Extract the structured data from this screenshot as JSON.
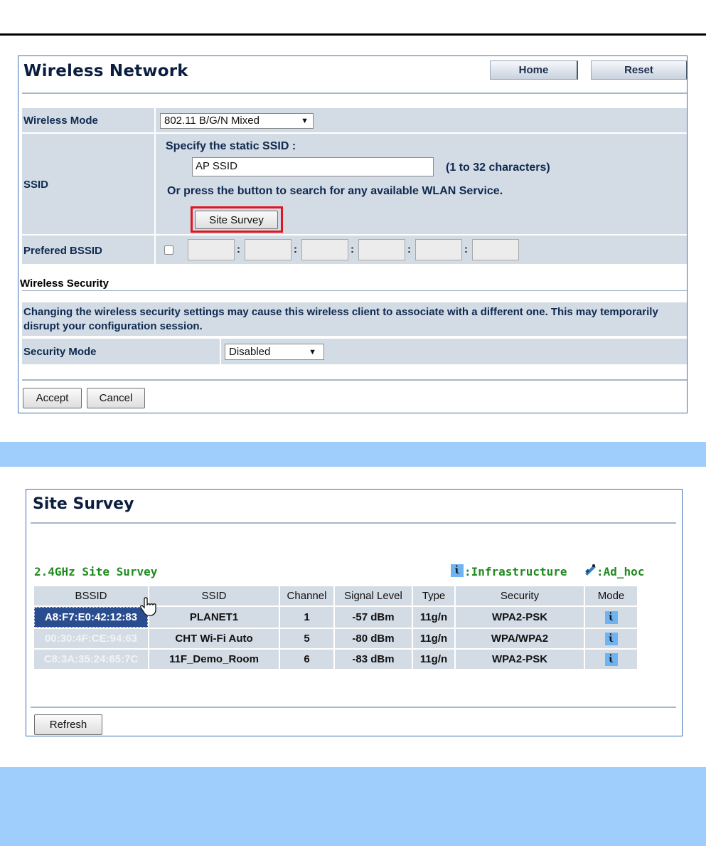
{
  "wireless_network": {
    "title": "Wireless Network",
    "home_label": "Home",
    "reset_label": "Reset",
    "wireless_mode_label": "Wireless Mode",
    "wireless_mode_value": "802.11 B/G/N Mixed",
    "ssid_label": "SSID",
    "ssid_prompt": "Specify the static SSID  :",
    "ssid_value": "AP SSID",
    "ssid_hint": "(1 to 32 characters)",
    "ssid_search_text": "Or press the button to search for any available WLAN Service.",
    "site_survey_button": "Site Survey",
    "preferred_bssid_label": "Prefered BSSID",
    "preferred_bssid_checked": false,
    "bssid_separators": [
      ":",
      ":",
      ":",
      ":",
      ":"
    ],
    "security_section_label": "Wireless Security",
    "security_warning": "Changing the wireless security settings may cause this wireless client to associate with a different one. This may temporarily disrupt your configuration session.",
    "security_mode_label": "Security Mode",
    "security_mode_value": "Disabled",
    "accept_label": "Accept",
    "cancel_label": "Cancel",
    "highlight_color": "#e4141e"
  },
  "site_survey": {
    "title": "Site Survey",
    "subtitle": "2.4GHz Site Survey",
    "legend_infra": ":Infrastructure",
    "legend_adhoc": ":Ad_hoc",
    "infra_icon": "infrastructure-icon",
    "adhoc_icon": "adhoc-icon",
    "columns": [
      "BSSID",
      "SSID",
      "Channel",
      "Signal Level",
      "Type",
      "Security",
      "Mode"
    ],
    "rows": [
      {
        "bssid": "A8:F7:E0:42:12:83",
        "ssid": "PLANET1",
        "channel": "1",
        "signal": "-57 dBm",
        "type": "11g/n",
        "security": "WPA2-PSK",
        "mode": "infrastructure"
      },
      {
        "bssid": "00:30:4F:CE:94:63",
        "ssid": "CHT Wi-Fi Auto",
        "channel": "5",
        "signal": "-80 dBm",
        "type": "11g/n",
        "security": "WPA/WPA2",
        "mode": "infrastructure"
      },
      {
        "bssid": "C8:3A:35:24:65:7C",
        "ssid": "11F_Demo_Room",
        "channel": "6",
        "signal": "-83 dBm",
        "type": "11g/n",
        "security": "WPA2-PSK",
        "mode": "infrastructure"
      }
    ],
    "refresh_label": "Refresh",
    "selected_row_color": "#2a4d8f"
  },
  "band_color": "#9fcdfc"
}
